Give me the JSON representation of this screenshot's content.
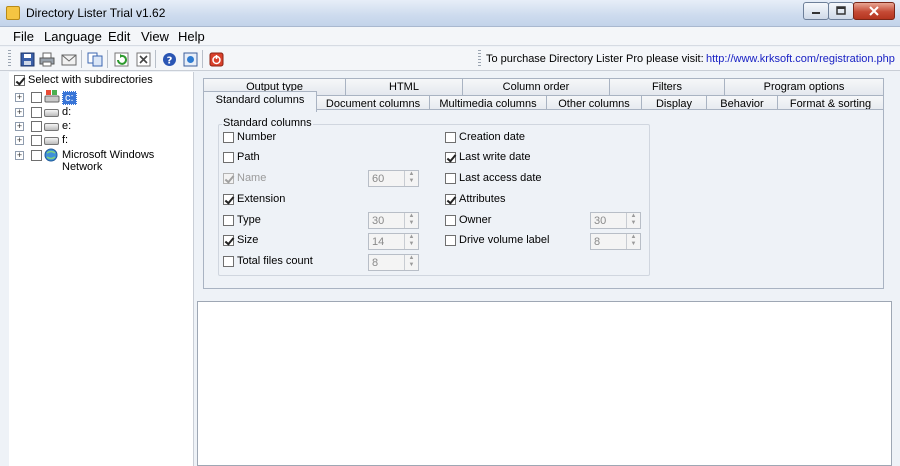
{
  "window": {
    "title": "Directory Lister Trial v1.62"
  },
  "menu": [
    "File",
    "Language",
    "Edit",
    "View",
    "Help"
  ],
  "toolbar": {
    "buttons": [
      "save-icon",
      "print-icon",
      "email-icon",
      "copy-icon",
      "refresh-icon",
      "clear-icon",
      "help-icon",
      "about-icon",
      "exit-icon"
    ],
    "purchase_text": "To purchase Directory Lister Pro please visit:",
    "purchase_link": "http://www.krksoft.com/registration.php"
  },
  "tree": {
    "select_subdirs_label": "Select with subdirectories",
    "select_subdirs_checked": true,
    "items": [
      {
        "label": "c:",
        "icon": "system-drive-icon",
        "selected": true
      },
      {
        "label": "d:",
        "icon": "drive-icon"
      },
      {
        "label": "e:",
        "icon": "drive-icon"
      },
      {
        "label": "f:",
        "icon": "drive-icon"
      },
      {
        "label": "Microsoft Windows Network",
        "icon": "network-icon"
      }
    ]
  },
  "tabs": {
    "row_back": [
      "Output type",
      "HTML",
      "Column order",
      "Filters",
      "Program options"
    ],
    "row_front": [
      "Standard columns",
      "Document columns",
      "Multimedia columns",
      "Other columns",
      "Display",
      "Behavior",
      "Format & sorting"
    ],
    "active": "Standard columns"
  },
  "standard_columns": {
    "group_title": "Standard columns",
    "left": [
      {
        "label": "Number",
        "checked": false,
        "enabled": true
      },
      {
        "label": "Path",
        "checked": false,
        "enabled": true
      },
      {
        "label": "Name",
        "checked": true,
        "enabled": false,
        "width": "60"
      },
      {
        "label": "Extension",
        "checked": true,
        "enabled": true
      },
      {
        "label": "Type",
        "checked": false,
        "enabled": true,
        "width": "30"
      },
      {
        "label": "Size",
        "checked": true,
        "enabled": true,
        "width": "14"
      },
      {
        "label": "Total files count",
        "checked": false,
        "enabled": true,
        "width": "8"
      }
    ],
    "right": [
      {
        "label": "Creation date",
        "checked": false,
        "enabled": true
      },
      {
        "label": "Last write date",
        "checked": true,
        "enabled": true
      },
      {
        "label": "Last access date",
        "checked": false,
        "enabled": true
      },
      {
        "label": "Attributes",
        "checked": true,
        "enabled": true
      },
      {
        "label": "Owner",
        "checked": false,
        "enabled": true,
        "width": "30"
      },
      {
        "label": "Drive volume label",
        "checked": false,
        "enabled": true,
        "width": "8"
      }
    ]
  }
}
